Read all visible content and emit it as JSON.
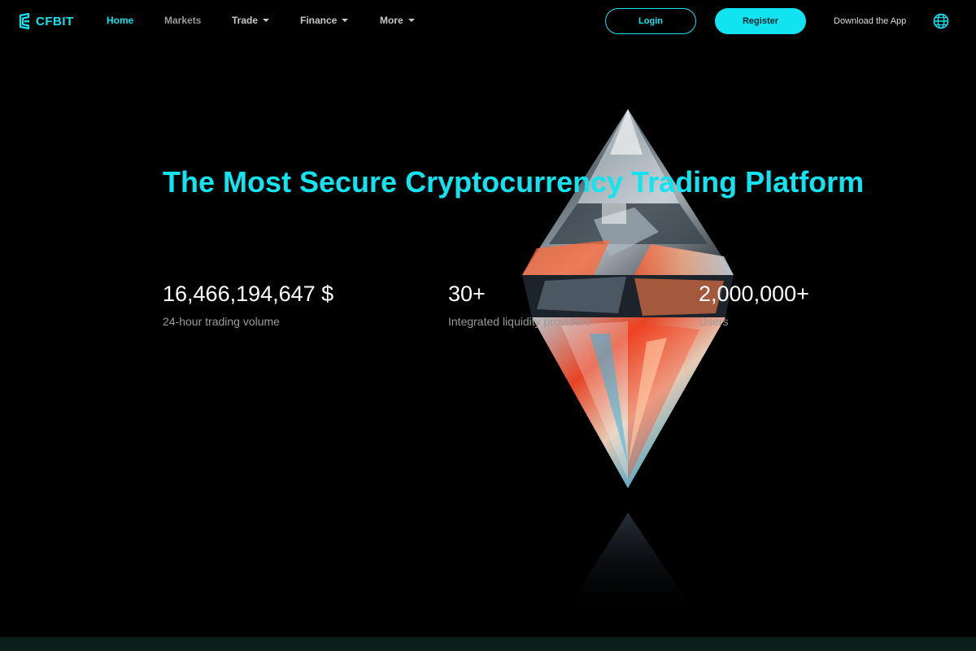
{
  "brand": {
    "name": "CFBIT",
    "accent": "#11e3f0"
  },
  "nav": {
    "items": [
      {
        "label": "Home",
        "active": true
      },
      {
        "label": "Markets",
        "active": false
      },
      {
        "label": "Trade",
        "dropdown": true
      },
      {
        "label": "Finance",
        "dropdown": true
      },
      {
        "label": "More",
        "dropdown": true
      }
    ],
    "login_label": "Login",
    "register_label": "Register",
    "download_label": "Download the App",
    "language_icon": "globe-icon"
  },
  "hero": {
    "title": "The Most Secure Cryptocurrency Trading Platform",
    "stats": [
      {
        "value": "16,466,194,647 $",
        "label": "24-hour trading volume"
      },
      {
        "value": "30+",
        "label": "Integrated liquidity providers"
      },
      {
        "value": "2,000,000+",
        "label": "Users"
      }
    ]
  }
}
